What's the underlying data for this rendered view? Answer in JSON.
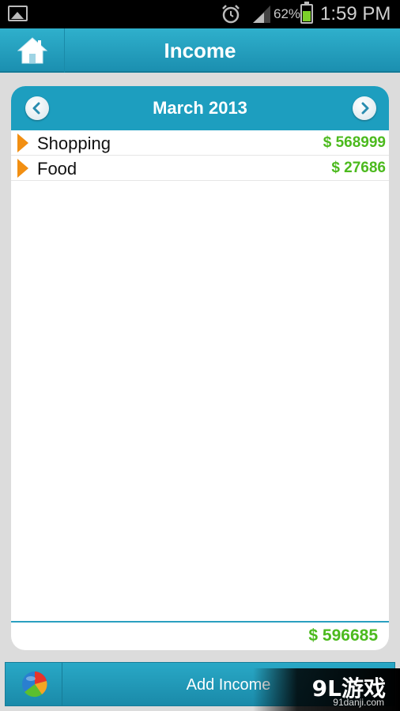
{
  "status_bar": {
    "battery_percent": "62%",
    "battery_level": 0.62,
    "time": "1:59 PM",
    "icons": [
      "gallery-icon",
      "alarm-icon",
      "signal-icon",
      "battery-icon"
    ]
  },
  "header": {
    "title": "Income",
    "home_icon": "home-icon"
  },
  "panel": {
    "month": "March 2013",
    "items": [
      {
        "name": "Shopping",
        "amount": "$ 568999"
      },
      {
        "name": "Food",
        "amount": "$ 27686"
      }
    ],
    "total": "$ 596685"
  },
  "footer": {
    "add_label": "Add Income",
    "chart_icon": "pie-chart-icon"
  },
  "watermark": {
    "brand": "9L游戏",
    "site": "91danji.com"
  },
  "colors": {
    "accent": "#1d9ebf",
    "amount": "#4cba1e",
    "arrow": "#f28f12"
  }
}
